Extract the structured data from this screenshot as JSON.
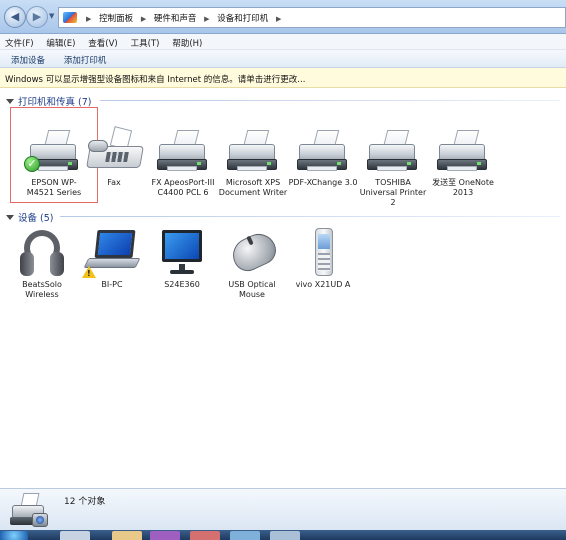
{
  "address_bar": {
    "breadcrumbs": [
      "控制面板",
      "硬件和声音",
      "设备和打印机"
    ]
  },
  "menu": [
    "文件(F)",
    "编辑(E)",
    "查看(V)",
    "工具(T)",
    "帮助(H)"
  ],
  "commands": [
    "添加设备",
    "添加打印机"
  ],
  "info_bar": "Windows 可以显示增强型设备图标和来自 Internet 的信息。请单击进行更改...",
  "printers_group": {
    "title": "打印机和传真 (7)",
    "items": [
      {
        "label": "EPSON WP-M4521 Series",
        "icon": "printer-icon",
        "default": true
      },
      {
        "label": "Fax",
        "icon": "fax-icon"
      },
      {
        "label": "FX ApeosPort-III C4400 PCL 6",
        "icon": "printer-icon"
      },
      {
        "label": "Microsoft XPS Document Writer",
        "icon": "printer-icon"
      },
      {
        "label": "PDF-XChange 3.0",
        "icon": "printer-icon"
      },
      {
        "label": "TOSHIBA Universal Printer 2",
        "icon": "printer-icon"
      },
      {
        "label": "发送至 OneNote 2013",
        "icon": "printer-icon"
      }
    ]
  },
  "devices_group": {
    "title": "设备 (5)",
    "items": [
      {
        "label": "BeatsSolo Wireless",
        "icon": "headphones-icon"
      },
      {
        "label": "BI-PC",
        "icon": "laptop-icon",
        "warning": true
      },
      {
        "label": "S24E360",
        "icon": "monitor-icon"
      },
      {
        "label": "USB Optical Mouse",
        "icon": "mouse-icon"
      },
      {
        "label": "vivo X21UD A",
        "icon": "phone-icon"
      }
    ]
  },
  "details_pane": {
    "count_text": "12 个对象"
  },
  "colors": {
    "group_title": "#1e3d8a",
    "selection_border": "#e66a6a",
    "info_bar_bg": "#fffbdc"
  }
}
